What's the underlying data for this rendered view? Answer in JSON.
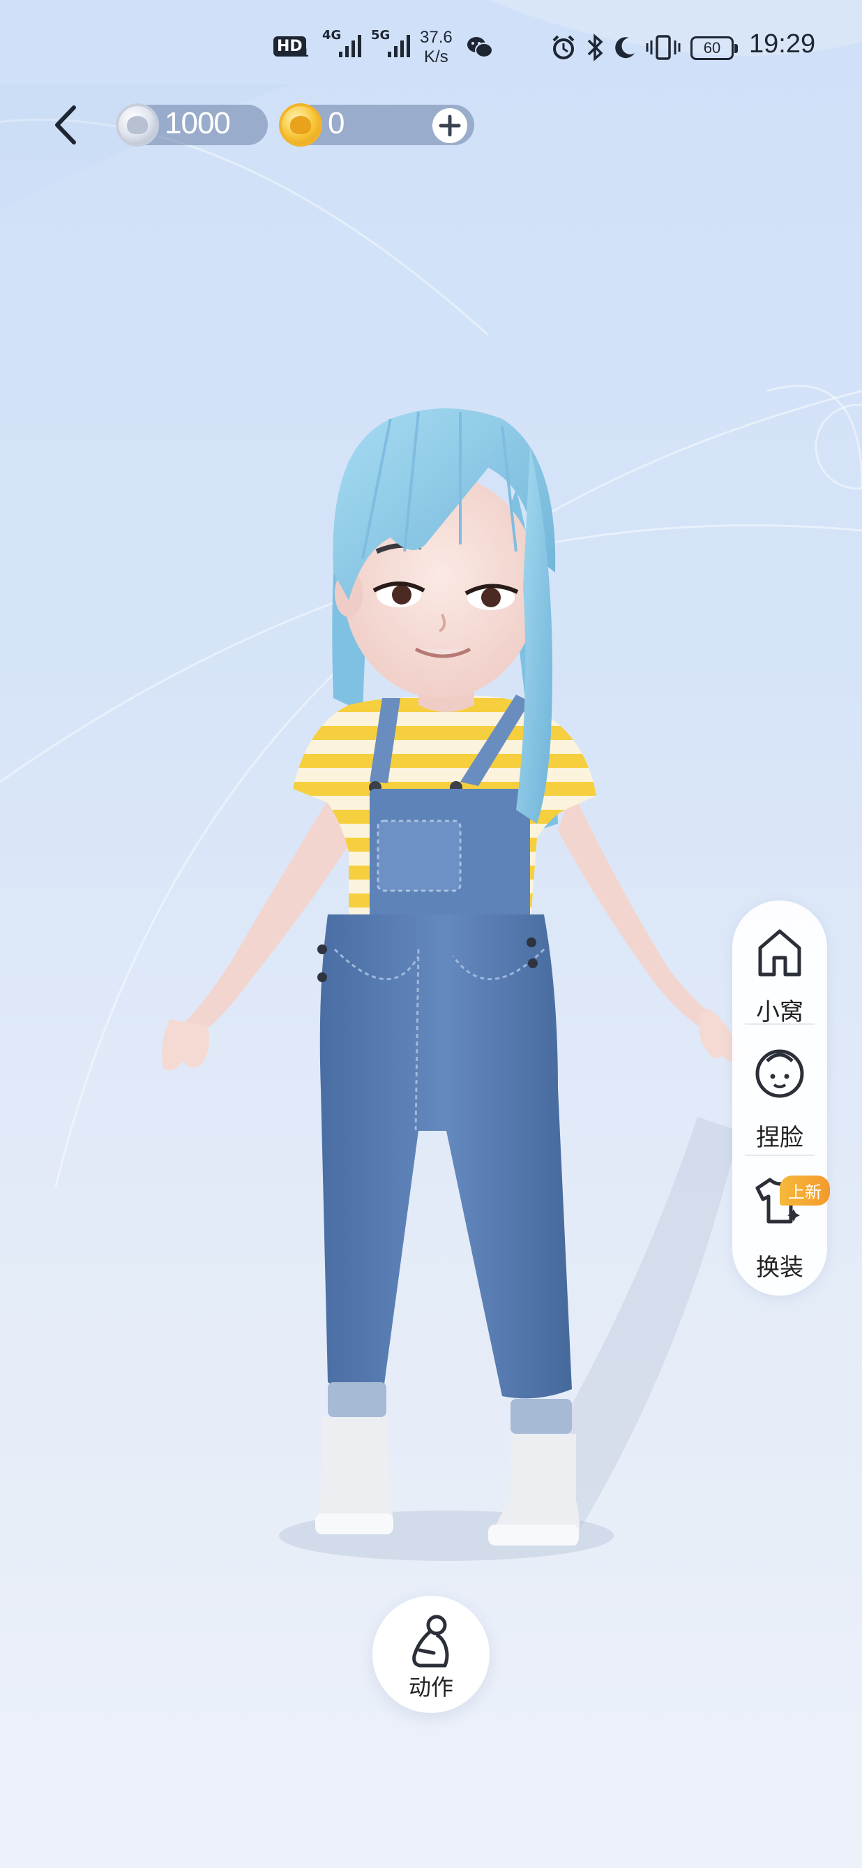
{
  "status_bar": {
    "hd": "HD",
    "hd_sub": "1",
    "net1": "4G",
    "net2": "5G",
    "speed_value": "37.6",
    "speed_unit": "K/s",
    "battery": "60",
    "time": "19:29"
  },
  "currency": {
    "silver_amount": "1000",
    "gold_amount": "0"
  },
  "side_menu": {
    "home_label": "小窝",
    "face_label": "捏脸",
    "outfit_label": "换装",
    "outfit_badge": "上新"
  },
  "action": {
    "label": "动作"
  },
  "colors": {
    "hair": "#8ecbe8",
    "shirt_stripe": "#f7d24a",
    "denim": "#5478ad",
    "skin": "#f5d9d4"
  }
}
